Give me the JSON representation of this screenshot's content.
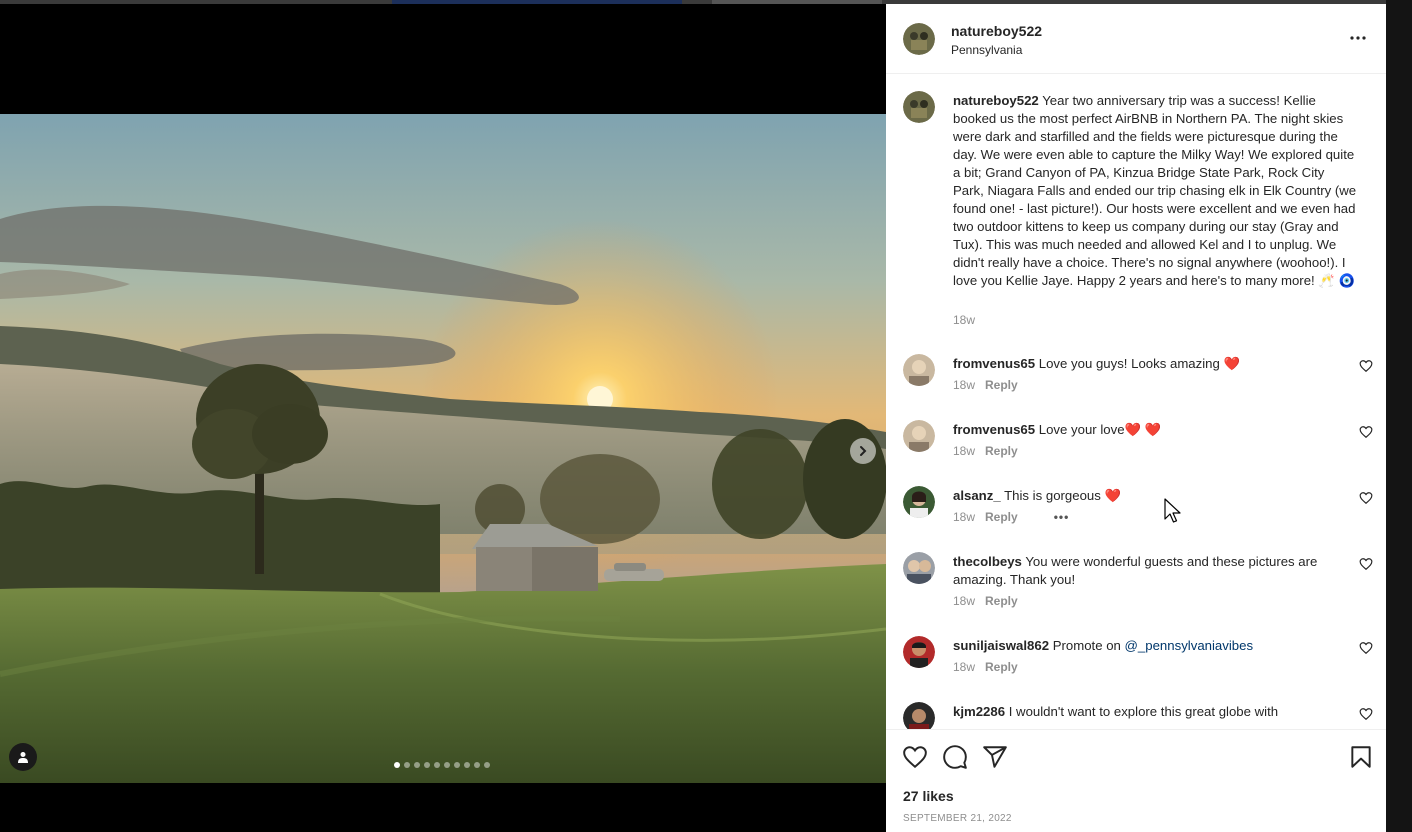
{
  "post": {
    "username": "natureboy522",
    "location": "Pennsylvania",
    "caption": "Year two anniversary trip was a success! Kellie booked us the most perfect AirBNB in Northern PA. The night skies were dark and starfilled and the fields were picturesque during the day. We were even able to capture the Milky Way! We explored quite a bit; Grand Canyon of PA, Kinzua Bridge State Park, Rock City Park, Niagara Falls and ended our trip chasing elk in Elk Country (we found one! - last picture!). Our hosts were excellent and we even had two outdoor kittens to keep us company during our stay (Gray and Tux). This was much needed and allowed Kel and I to unplug. We didn't really have a choice. There's no signal anywhere (woohoo!). I love you Kellie Jaye. Happy 2 years and here's to many more! 🥂 🧿",
    "caption_time": "18w",
    "likes": "27 likes",
    "date": "SEPTEMBER 21, 2022",
    "carousel": {
      "total": 10,
      "active": 0
    }
  },
  "comments": [
    {
      "username": "fromvenus65",
      "text": "Love you guys! Looks amazing ",
      "emoji": "❤️",
      "time": "18w",
      "reply": "Reply"
    },
    {
      "username": "fromvenus65",
      "text": "Love your love",
      "emoji": "❤️ ❤️",
      "time": "18w",
      "reply": "Reply"
    },
    {
      "username": "alsanz_",
      "text": "This is gorgeous ",
      "emoji": "❤️",
      "time": "18w",
      "reply": "Reply",
      "more": "•••"
    },
    {
      "username": "thecolbeys",
      "text": "You were wonderful guests and these pictures are amazing. Thank you!",
      "time": "18w",
      "reply": "Reply"
    },
    {
      "username": "suniljaiswal862",
      "text": "Promote on ",
      "mention": "@_pennsylvaniavibes",
      "time": "18w",
      "reply": "Reply"
    },
    {
      "username": "kjm2286",
      "text": "I wouldn't want to explore this great globe with"
    }
  ],
  "colors": {
    "like_red": "#e0201e",
    "link_blue": "#00376b",
    "muted": "#8e8e8e"
  },
  "icons": [
    "more-icon",
    "chevron-right-icon",
    "user-tag-icon",
    "heart-icon",
    "comment-icon",
    "share-icon",
    "bookmark-icon"
  ]
}
